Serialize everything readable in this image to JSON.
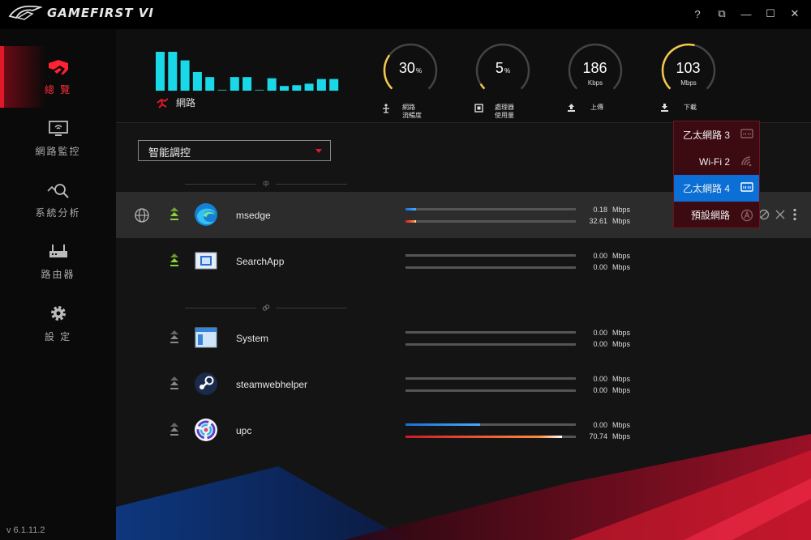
{
  "app": {
    "title": "GAMEFIRST VI",
    "version": "v 6.1.11.2"
  },
  "window_controls": [
    {
      "name": "help-button",
      "label": "?"
    },
    {
      "name": "mini-mode-button",
      "label": "⧉"
    },
    {
      "name": "minimize-button",
      "label": "—"
    },
    {
      "name": "maximize-button",
      "label": "☐"
    },
    {
      "name": "close-button",
      "label": "✕"
    }
  ],
  "sidebar": {
    "items": [
      {
        "label": "總 覽",
        "icon": "rog-eye-icon",
        "active": true
      },
      {
        "label": "網路監控",
        "icon": "monitor-wifi-icon",
        "active": false
      },
      {
        "label": "系統分析",
        "icon": "analysis-magnifier-icon",
        "active": false
      },
      {
        "label": "路由器",
        "icon": "router-icon",
        "active": false
      },
      {
        "label": "設 定",
        "icon": "gear-icon",
        "active": false
      }
    ]
  },
  "header": {
    "network_label": "網路",
    "bar_levels": [
      1.0,
      1.0,
      0.78,
      0.48,
      0.35,
      0.0,
      0.35,
      0.35,
      0.0,
      0.32,
      0.12,
      0.14,
      0.18,
      0.3,
      0.3
    ],
    "gauges": [
      {
        "value": "30",
        "suffix": "%",
        "unit": "",
        "caption": "網路\n流暢度",
        "icon": "network-flow-icon",
        "fraction": 0.3
      },
      {
        "value": "5",
        "suffix": "%",
        "unit": "",
        "caption": "處理器\n使用量",
        "icon": "cpu-icon",
        "fraction": 0.05
      },
      {
        "value": "186",
        "suffix": "",
        "unit": "Kbps",
        "caption": "上傳",
        "icon": "upload-icon",
        "fraction": 0.0
      },
      {
        "value": "103",
        "suffix": "",
        "unit": "Mbps",
        "caption": "下載",
        "icon": "download-icon",
        "fraction": 0.55
      }
    ]
  },
  "mode_select": {
    "value": "智能調控"
  },
  "groups": [
    {
      "label": "中"
    },
    {
      "label": ""
    }
  ],
  "apps": [
    {
      "name": "msedge",
      "up": "0.18",
      "down": "32.61",
      "unit": "Mbps",
      "up_frac": 0.06,
      "down_frac": 0.06,
      "highlight": true
    },
    {
      "name": "SearchApp",
      "up": "0.00",
      "down": "0.00",
      "unit": "Mbps",
      "up_frac": 0,
      "down_frac": 0,
      "highlight": false
    },
    {
      "name": "System",
      "up": "0.00",
      "down": "0.00",
      "unit": "Mbps",
      "up_frac": 0,
      "down_frac": 0,
      "highlight": false
    },
    {
      "name": "steamwebhelper",
      "up": "0.00",
      "down": "0.00",
      "unit": "Mbps",
      "up_frac": 0,
      "down_frac": 0,
      "highlight": false
    },
    {
      "name": "upc",
      "up": "0.00",
      "down": "70.74",
      "unit": "Mbps",
      "up_frac": 0.44,
      "down_frac": 0.92,
      "highlight": false
    }
  ],
  "network_dropdown": {
    "items": [
      {
        "label": "乙太網路 3",
        "icon": "ethernet-icon",
        "selected": false
      },
      {
        "label": "Wi-Fi 2",
        "icon": "wifi-icon",
        "selected": false
      },
      {
        "label": "乙太網路 4",
        "icon": "ethernet-icon",
        "selected": true
      },
      {
        "label": "預設網路",
        "icon": "auto-icon",
        "selected": false
      }
    ]
  },
  "colors": {
    "accent_red": "#e0182a",
    "bar_cyan": "#19d9e8",
    "gauge_gold": "#f2c94c",
    "select_blue": "#0b6fd6"
  }
}
